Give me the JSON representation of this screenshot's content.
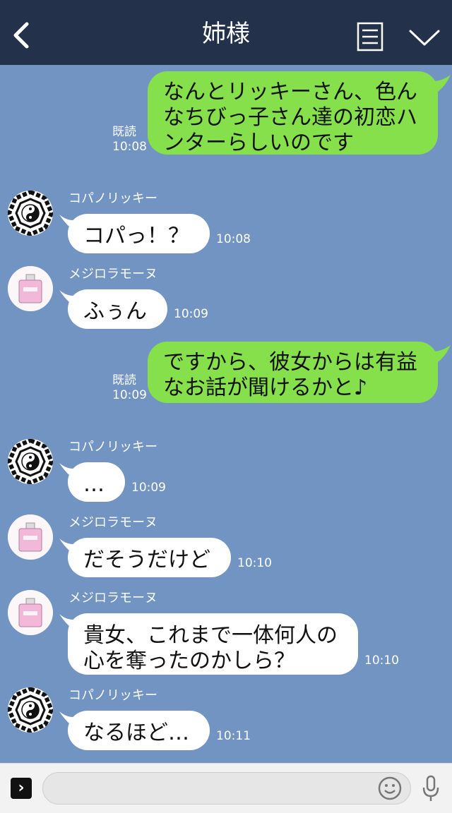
{
  "header": {
    "title": "姉様"
  },
  "messages": [
    {
      "side": "mine",
      "text": "なんとリッキーさん、色ん\nなちびっ子さん達の初恋ハ\nンターらしいのです",
      "read": "既読",
      "time": "10:08"
    },
    {
      "side": "theirs",
      "sender": "コパノリッキー",
      "avatar": "yin-yang-bagua",
      "text": "コパっ！？",
      "time": "10:08"
    },
    {
      "side": "theirs",
      "sender": "メジロラモーヌ",
      "avatar": "perfume-bottle",
      "text": "ふぅん",
      "time": "10:09"
    },
    {
      "side": "mine",
      "text": "ですから、彼女からは有益\nなお話が聞けるかと♪",
      "read": "既読",
      "time": "10:09"
    },
    {
      "side": "theirs",
      "sender": "コパノリッキー",
      "avatar": "yin-yang-bagua",
      "text": "…",
      "time": "10:09"
    },
    {
      "side": "theirs",
      "sender": "メジロラモーヌ",
      "avatar": "perfume-bottle",
      "text": "だそうだけど",
      "time": "10:10"
    },
    {
      "side": "theirs",
      "sender": "メジロラモーヌ",
      "avatar": "perfume-bottle",
      "text": "貴女、これまで一体何人の\n心を奪ったのかしら？",
      "time": "10:10"
    },
    {
      "side": "theirs",
      "sender": "コパノリッキー",
      "avatar": "yin-yang-bagua",
      "text": "なるほど…",
      "time": "10:11"
    }
  ],
  "input": {
    "placeholder": "",
    "value": ""
  },
  "colors": {
    "background": "#7294c2",
    "header": "#23314a",
    "mine_bubble": "#86e04c",
    "theirs_bubble": "#ffffff"
  },
  "icons": {
    "back": "chevron-left-icon",
    "notes": "notes-icon",
    "menu": "chevron-down-icon",
    "expand": "expand-icon",
    "emoji": "emoji-icon",
    "mic": "mic-icon"
  }
}
